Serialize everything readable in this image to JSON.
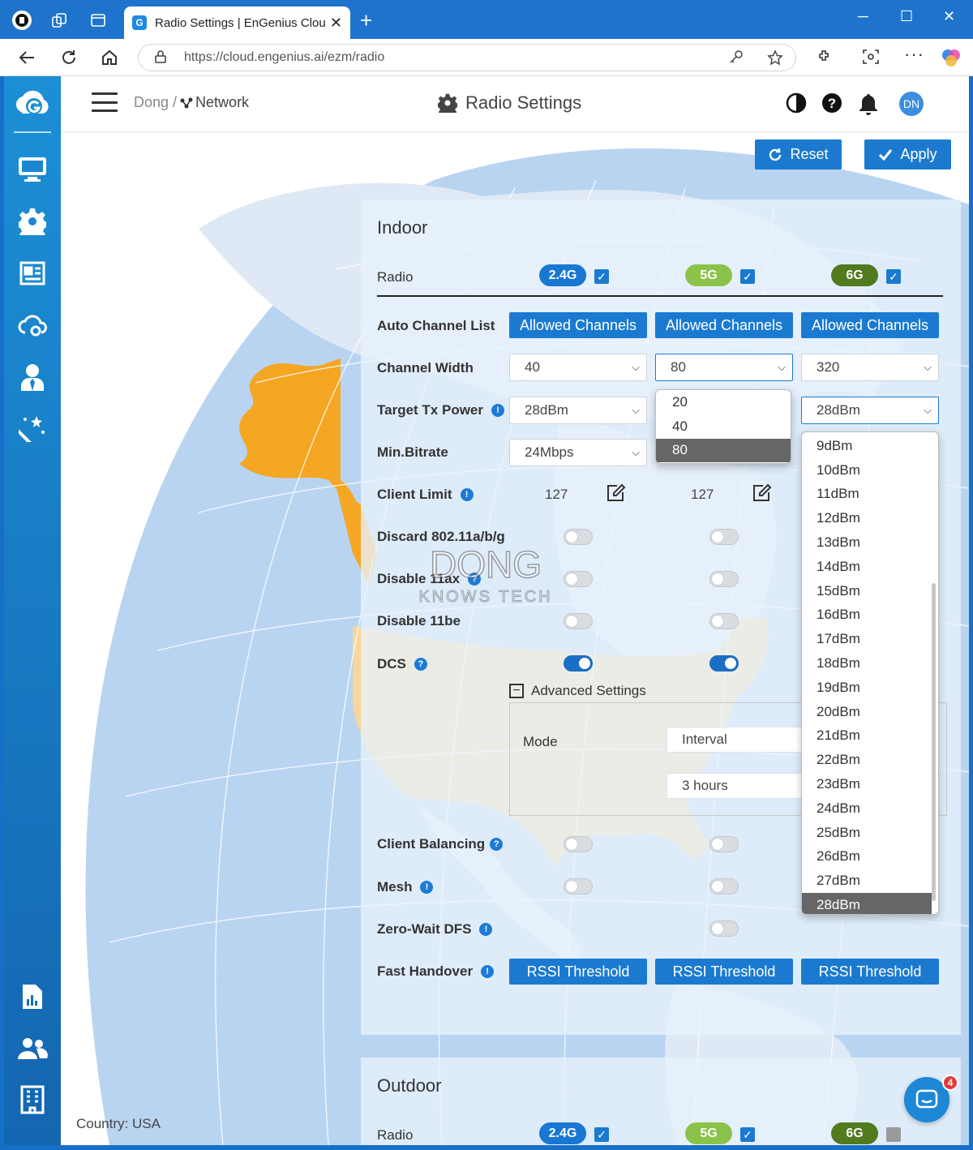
{
  "browser": {
    "tab_title": "Radio Settings | EnGenius Cloud -",
    "url": "https://cloud.engenius.ai/ezm/radio"
  },
  "header": {
    "breadcrumb_org": "Dong /",
    "breadcrumb_network": "Network",
    "page_title": "Radio Settings",
    "avatar_initials": "DN"
  },
  "actions": {
    "reset_label": "Reset",
    "apply_label": "Apply"
  },
  "map": {
    "country_label": "Country: USA"
  },
  "indoor": {
    "title": "Indoor",
    "radio_label": "Radio",
    "bands": [
      {
        "label": "2.4G",
        "color": "#1877d2",
        "checked": true
      },
      {
        "label": "5G",
        "color": "#8bc34a",
        "checked": true
      },
      {
        "label": "6G",
        "color": "#527a1e",
        "checked": true
      }
    ],
    "auto_channel_label": "Auto Channel List",
    "allowed_channels_label": "Allowed Channels",
    "channel_width_label": "Channel Width",
    "channel_width_values": [
      "40",
      "80",
      "320"
    ],
    "channel_width_options": [
      "20",
      "40",
      "80"
    ],
    "channel_width_selected": "80",
    "target_tx_label": "Target Tx Power",
    "target_tx_values": [
      "28dBm",
      "28dBm"
    ],
    "tx_power_options": [
      "9dBm",
      "10dBm",
      "11dBm",
      "12dBm",
      "13dBm",
      "14dBm",
      "15dBm",
      "16dBm",
      "17dBm",
      "18dBm",
      "19dBm",
      "20dBm",
      "21dBm",
      "22dBm",
      "23dBm",
      "24dBm",
      "25dBm",
      "26dBm",
      "27dBm",
      "28dBm"
    ],
    "tx_power_selected": "28dBm",
    "min_bitrate_label": "Min.Bitrate",
    "min_bitrate_value": "24Mbps",
    "client_limit_label": "Client Limit",
    "client_limit_values": [
      "127",
      "127"
    ],
    "discard_label": "Discard 802.11a/b/g",
    "disable11ax_label": "Disable 11ax",
    "disable11be_label": "Disable 11be",
    "dcs_label": "DCS",
    "advanced_label": "Advanced Settings",
    "mode_label": "Mode",
    "mode_value": "Interval",
    "interval_value": "3 hours",
    "client_balancing_label": "Client Balancing",
    "mesh_label": "Mesh",
    "zero_wait_label": "Zero-Wait DFS",
    "fast_handover_label": "Fast Handover",
    "rssi_label": "RSSI Threshold"
  },
  "outdoor": {
    "title": "Outdoor",
    "radio_label": "Radio",
    "bands": [
      {
        "label": "2.4G",
        "checked": true
      },
      {
        "label": "5G",
        "checked": true
      },
      {
        "label": "6G",
        "checked": false
      }
    ]
  },
  "watermark": {
    "top": "DONG",
    "bottom": "KNOWS TECH"
  },
  "chat": {
    "badge_count": "4"
  },
  "colors": {
    "accent": "#1b7ad0",
    "sidebar": "#1c8fd6",
    "usa": "#f8d69b",
    "alaska": "#f5a623",
    "ocean": "#b7d3f0"
  }
}
